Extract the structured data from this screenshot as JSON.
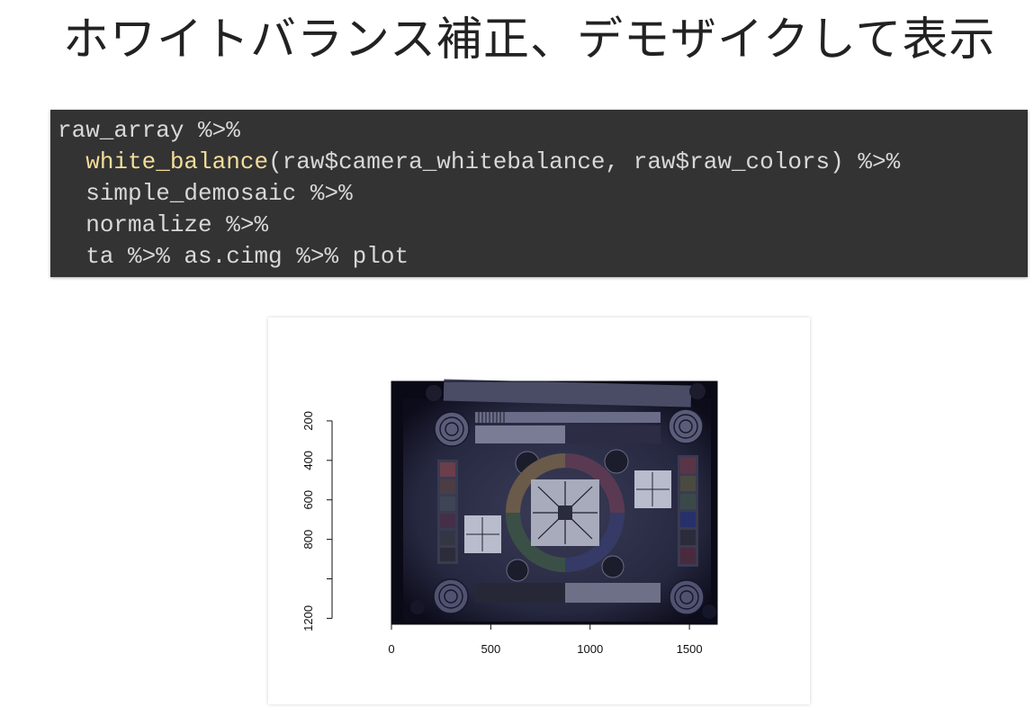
{
  "slide": {
    "title": "ホワイトバランス補正、デモザイクして表示"
  },
  "code": {
    "language": "r",
    "lines": [
      {
        "indent": "",
        "parts": [
          {
            "text": "raw_array %>%",
            "kind": "plain"
          }
        ]
      },
      {
        "indent": "  ",
        "parts": [
          {
            "text": "white_balance",
            "kind": "function"
          },
          {
            "text": "(raw$camera_whitebalance, raw$raw_colors) %>%",
            "kind": "plain"
          }
        ]
      },
      {
        "indent": "  ",
        "parts": [
          {
            "text": "simple_demosaic %>%",
            "kind": "plain"
          }
        ]
      },
      {
        "indent": "  ",
        "parts": [
          {
            "text": "normalize %>%",
            "kind": "plain"
          }
        ]
      },
      {
        "indent": "  ",
        "parts": [
          {
            "text": "ta %>% as.cimg %>% plot",
            "kind": "plain"
          }
        ]
      }
    ],
    "colors": {
      "background": "#333333",
      "text": "#d8d8d8",
      "function": "#f4dd9a"
    }
  },
  "plot": {
    "image_description_kind": "white-balanced demosaiced raw photo of a resolution test chart",
    "x_axis": {
      "ticks": [
        0,
        500,
        1000,
        1500
      ],
      "range": [
        0,
        1640
      ]
    },
    "y_axis": {
      "ticks": [
        200,
        400,
        600,
        800,
        1000,
        1200
      ],
      "labels": [
        "200",
        "400",
        "600",
        "800",
        "",
        "1200"
      ],
      "range": [
        0,
        1230
      ],
      "reversed": true
    },
    "colors": {
      "chart_bg": "#2a2b44",
      "frame": "#0b0b18"
    }
  }
}
